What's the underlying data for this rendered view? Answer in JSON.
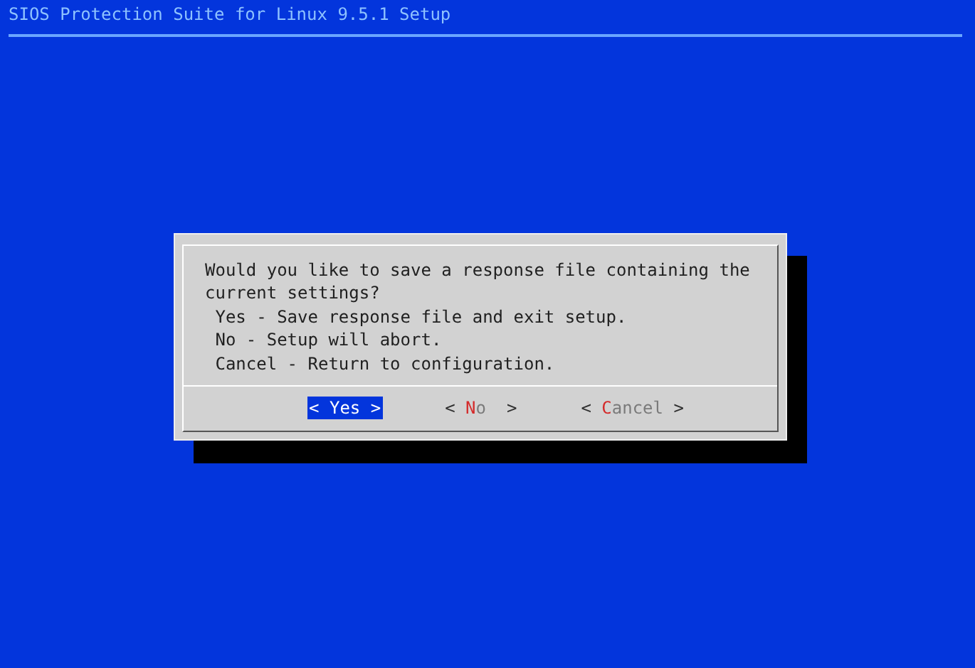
{
  "window": {
    "title": "SIOS Protection Suite for Linux 9.5.1 Setup"
  },
  "dialog": {
    "message_lines": [
      "Would you like to save a response file containing the",
      "current settings?",
      " Yes - Save response file and exit setup.",
      " No - Setup will abort.",
      " Cancel - Return to configuration."
    ],
    "buttons": [
      {
        "open": "< ",
        "hotkey": "Y",
        "rest": "es",
        "close": " >",
        "selected": true
      },
      {
        "open": "< ",
        "hotkey": "N",
        "rest": "o ",
        "close": " >",
        "selected": false
      },
      {
        "open": "< ",
        "hotkey": "C",
        "rest": "ancel",
        "close": " >",
        "selected": false
      }
    ]
  }
}
